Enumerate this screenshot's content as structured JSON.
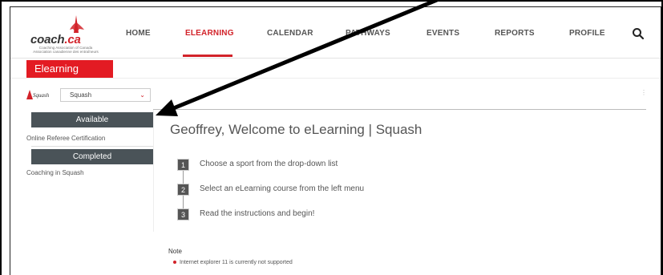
{
  "logo": {
    "word_main": "coach",
    "word_ca": ".ca",
    "subtitle_line1": "Coaching Association of Canada",
    "subtitle_line2": "Association canadienne des entraîneurs"
  },
  "nav": {
    "home": "HOME",
    "elearning": "ELEARNING",
    "calendar": "CALENDAR",
    "pathways": "PATHWAYS",
    "events": "EVENTS",
    "reports": "REPORTS",
    "profile": "PROFILE"
  },
  "page_tab": "Elearning",
  "sport_select": {
    "logo_text": "Squash",
    "value": "Squash"
  },
  "menu": {
    "available_label": "Available",
    "available_items": [
      "Online Referee Certification"
    ],
    "completed_label": "Completed",
    "completed_items": [
      "Coaching in Squash"
    ]
  },
  "main": {
    "welcome": "Geoffrey, Welcome to eLearning | Squash",
    "steps": [
      {
        "num": "1",
        "text": "Choose a sport from the drop-down list"
      },
      {
        "num": "2",
        "text": "Select an eLearning course from the left menu"
      },
      {
        "num": "3",
        "text": "Read the instructions and begin!"
      }
    ]
  },
  "note": {
    "title": "Note",
    "items": [
      "Internet explorer 11 is currently not supported"
    ]
  },
  "colors": {
    "brand_red": "#d2232a",
    "menu_header": "#4a5358"
  }
}
